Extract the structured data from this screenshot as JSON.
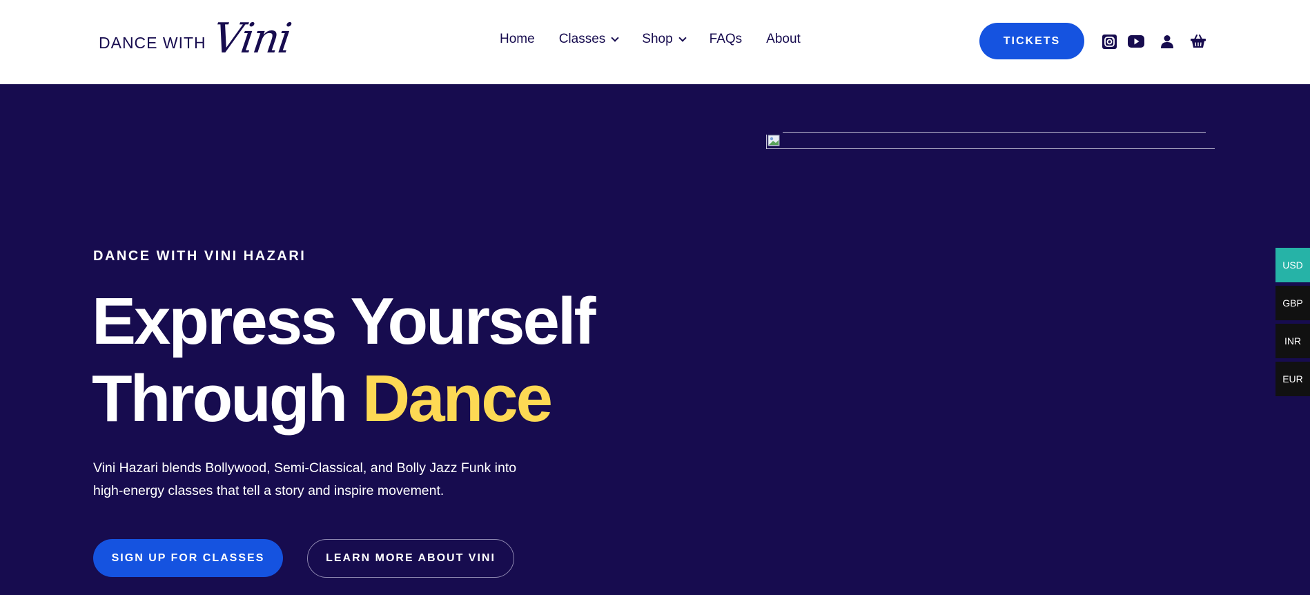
{
  "header": {
    "logo_text": "DANCE WITH",
    "logo_script": "Vini",
    "nav": [
      {
        "label": "Home"
      },
      {
        "label": "Classes"
      },
      {
        "label": "Shop"
      },
      {
        "label": "FAQs"
      },
      {
        "label": "About"
      }
    ],
    "tickets_label": "TICKETS",
    "icons": [
      "instagram-icon",
      "youtube-icon",
      "user-icon",
      "basket-icon"
    ]
  },
  "hero": {
    "eyebrow": "DANCE WITH VINI HAZARI",
    "title_line1": "Express Yourself",
    "title_line2_prefix": "Through ",
    "title_line2_accent": "Dance",
    "description": "Vini Hazari blends Bollywood, Semi-Classical, and Bolly Jazz Funk into high-energy classes that tell a story and inspire movement.",
    "primary_cta": "SIGN UP FOR CLASSES",
    "secondary_cta": "LEARN MORE ABOUT VINI"
  },
  "currency_switcher": [
    {
      "code": "USD",
      "color": "#26b3a7"
    },
    {
      "code": "GBP",
      "color": "#111111"
    },
    {
      "code": "INR",
      "color": "#111111"
    },
    {
      "code": "EUR",
      "color": "#111111"
    }
  ],
  "colors": {
    "brand_navy": "#170c4f",
    "accent_blue": "#1553e0",
    "accent_yellow": "#fdd954"
  }
}
